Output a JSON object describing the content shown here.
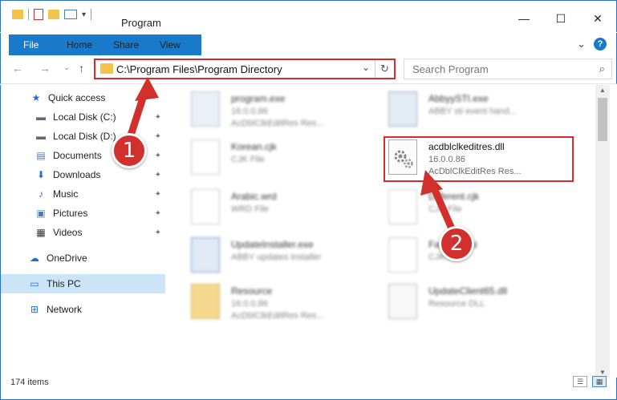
{
  "window": {
    "title": "Program",
    "minimize_glyph": "—",
    "maximize_glyph": "☐",
    "close_glyph": "✕"
  },
  "ribbon": {
    "tabs": [
      "File",
      "Home",
      "Share",
      "View"
    ],
    "expand_glyph": "⌄",
    "help_glyph": "?"
  },
  "nav": {
    "back": "←",
    "forward": "→",
    "recent": "⌄",
    "up": "↑",
    "address": "C:\\Program Files\\Program Directory",
    "address_chevron": "⌄",
    "refresh_glyph": "↻",
    "search_placeholder": "Search Program",
    "search_glyph": "⌕"
  },
  "sidebar": {
    "items": [
      {
        "label": "Quick access",
        "icon": "star-icon",
        "glyph": "★",
        "color": "#1e6fd0",
        "pinned": false
      },
      {
        "label": "Local Disk (C:)",
        "icon": "drive-icon",
        "glyph": "▬",
        "color": "#5a6a7a",
        "pinned": true
      },
      {
        "label": "Local Disk (D:)",
        "icon": "drive-icon",
        "glyph": "▬",
        "color": "#5a6a7a",
        "pinned": true
      },
      {
        "label": "Documents",
        "icon": "documents-icon",
        "glyph": "▤",
        "color": "#4a7ab0",
        "pinned": true
      },
      {
        "label": "Downloads",
        "icon": "downloads-icon",
        "glyph": "⬇",
        "color": "#1e6fd0",
        "pinned": true
      },
      {
        "label": "Music",
        "icon": "music-icon",
        "glyph": "♪",
        "color": "#1e6fd0",
        "pinned": true
      },
      {
        "label": "Pictures",
        "icon": "pictures-icon",
        "glyph": "▣",
        "color": "#4a7ab0",
        "pinned": true
      },
      {
        "label": "Videos",
        "icon": "videos-icon",
        "glyph": "▦",
        "color": "#333333",
        "pinned": true
      },
      {
        "label": "OneDrive",
        "icon": "cloud-icon",
        "glyph": "☁",
        "color": "#1e6fd0",
        "pinned": false
      },
      {
        "label": "This PC",
        "icon": "computer-icon",
        "glyph": "▭",
        "color": "#1e6fd0",
        "pinned": false
      },
      {
        "label": "Network",
        "icon": "network-icon",
        "glyph": "⊞",
        "color": "#1e6fd0",
        "pinned": false
      }
    ],
    "pin_glyph": "📌"
  },
  "files": [
    {
      "name": "program.exe",
      "line1": "16.0.0.86",
      "line2": "AcDblClkEditRes Res...",
      "icon": "exe-icon",
      "blur": true
    },
    {
      "name": "AbbyySTI.exe",
      "line1": "ABBY sti event hand...",
      "line2": "",
      "icon": "exe-icon",
      "blur": true
    },
    {
      "name": "Korean.cjk",
      "line1": "CJK File",
      "line2": "",
      "icon": "blank-file-icon",
      "blur": true
    },
    {
      "name": "acdblclkeditres.dll",
      "line1": "16.0.0.86",
      "line2": "AcDblClkEditRes Res...",
      "icon": "dll-gear-icon",
      "blur": false
    },
    {
      "name": "Arabic.wrd",
      "line1": "WRD File",
      "line2": "",
      "icon": "blank-file-icon",
      "blur": true
    },
    {
      "name": "Different.cjk",
      "line1": "CJK File",
      "line2": "",
      "icon": "blank-file-icon",
      "blur": true
    },
    {
      "name": "UpdateInstaller.exe",
      "line1": "ABBY updates installer",
      "line2": "",
      "icon": "exe-icon",
      "blur": true
    },
    {
      "name": "FastSort.ini",
      "line1": "CJK File",
      "line2": "",
      "icon": "blank-file-icon",
      "blur": true
    },
    {
      "name": "Resource",
      "line1": "16.0.0.86",
      "line2": "AcDblClkEditRes Res...",
      "icon": "folder-archive-icon",
      "blur": true
    },
    {
      "name": "UpdateClient65.dll",
      "line1": "Resource DLL",
      "line2": "",
      "icon": "dll-gear-icon",
      "blur": true
    }
  ],
  "callouts": [
    "1",
    "2"
  ],
  "status": {
    "count": "174 items"
  },
  "colors": {
    "accent": "#1979ca",
    "highlight": "#d92b2b",
    "callout": "#d2302c",
    "selected_bg": "#cce4f7"
  }
}
